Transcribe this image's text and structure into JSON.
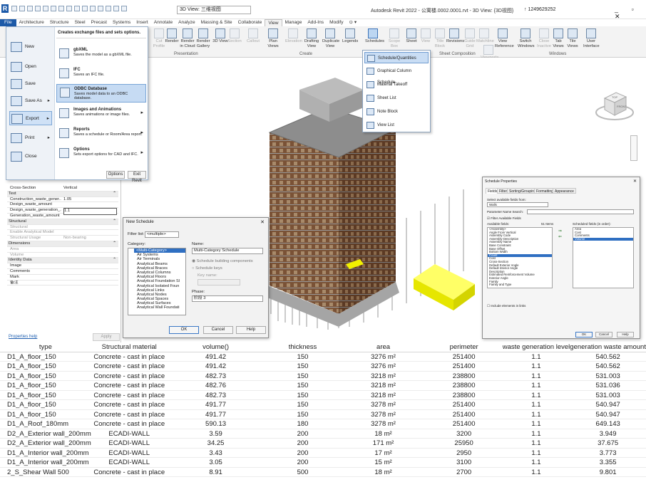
{
  "app": {
    "logo": "R",
    "title": "Autodesk Revit 2022 - 公寓楼.0002.0001.rvt - 3D View: {3D视图}",
    "view_combo": "3D View: 三维视图",
    "account": "↑ 1249629252",
    "window_buttons": "_ ▫ ✕"
  },
  "menu_tabs": [
    "File",
    "Architecture",
    "Structure",
    "Steel",
    "Precast",
    "Systems",
    "Insert",
    "Annotate",
    "Analyze",
    "Massing & Site",
    "Collaborate",
    "View",
    "Manage",
    "Add-Ins",
    "Modify",
    "⊙ ▾"
  ],
  "active_tab": "View",
  "ribbon": {
    "buttons": [
      {
        "label": "Cut Profile",
        "dim": true
      },
      {
        "label": "Render",
        "dim": false
      },
      {
        "label": "Render in Cloud",
        "dim": false
      },
      {
        "label": "Render Gallery",
        "dim": false
      },
      {
        "label": "3D View",
        "dim": false
      },
      {
        "label": "Section",
        "dim": true
      },
      {
        "label": "Callout",
        "dim": true
      },
      {
        "label": "Plan Views",
        "dim": false
      },
      {
        "label": "Elevation",
        "dim": true
      },
      {
        "label": "Drafting View",
        "dim": false
      },
      {
        "label": "Duplicate View",
        "dim": false
      },
      {
        "label": "Legends",
        "dim": false
      },
      {
        "label": "Schedules",
        "dim": false
      },
      {
        "label": "Scope Box",
        "dim": true
      },
      {
        "label": "Sheet",
        "dim": false
      },
      {
        "label": "View",
        "dim": true
      },
      {
        "label": "Title Block",
        "dim": true
      },
      {
        "label": "Revisions",
        "dim": false
      },
      {
        "label": "Guide Grid",
        "dim": true
      },
      {
        "label": "Matchline",
        "dim": true
      },
      {
        "label": "View Reference",
        "dim": false
      },
      {
        "label": "Viewports",
        "dim": true
      },
      {
        "label": "Switch Windows",
        "dim": false
      },
      {
        "label": "Close Inactive",
        "dim": true
      },
      {
        "label": "Tab Views",
        "dim": false
      },
      {
        "label": "Tile Views",
        "dim": false
      },
      {
        "label": "User Interface",
        "dim": false
      }
    ],
    "groups": [
      "Presentation",
      "Create",
      "Sheet Composition",
      "Windows"
    ]
  },
  "file_menu": {
    "items": [
      "New",
      "Open",
      "Save",
      "Save As",
      "Export",
      "Print",
      "Close"
    ],
    "selected": "Export",
    "header": "Creates exchange files and sets options.",
    "exports": [
      {
        "title": "gbXML",
        "desc": "Saves the model as a gbXML file."
      },
      {
        "title": "IFC",
        "desc": "Saves an IFC file."
      },
      {
        "title": "ODBC Database",
        "desc": "Saves model data to an ODBC database."
      },
      {
        "title": "Images and Animations",
        "desc": "Saves animations or image files."
      },
      {
        "title": "Reports",
        "desc": "Saves a schedule or Room/Area report."
      },
      {
        "title": "Options",
        "desc": "Sets export options for CAD and IFC."
      }
    ],
    "options_btn": "Options",
    "exit_btn": "Exit Revit"
  },
  "schedule_menu": {
    "items": [
      "Schedule/Quantities",
      "Graphical Column Schedule",
      "Material Takeoff",
      "Sheet List",
      "Note Block",
      "View List"
    ],
    "selected": "Schedule/Quantities"
  },
  "properties": {
    "rows": [
      {
        "k": "Cross-Section",
        "v": "Vertical",
        "type": "row"
      },
      {
        "k": "Text",
        "v": "",
        "type": "hdr"
      },
      {
        "k": "Construction_waste_gener...",
        "v": "1.05",
        "type": "row"
      },
      {
        "k": "Design_waste_amount",
        "v": "",
        "type": "row"
      },
      {
        "k": "Design_waste_generation_...",
        "v": "1.1",
        "type": "row"
      },
      {
        "k": "Generation_waste_amount",
        "v": "",
        "type": "row"
      },
      {
        "k": "Structural",
        "v": "",
        "type": "hdr"
      },
      {
        "k": "Structural",
        "v": "",
        "type": "gray"
      },
      {
        "k": "Enable Analytical Model",
        "v": "",
        "type": "gray"
      },
      {
        "k": "Structural Usage",
        "v": "Non-bearing",
        "type": "gray"
      },
      {
        "k": "Dimensions",
        "v": "",
        "type": "hdr"
      },
      {
        "k": "Area",
        "v": "",
        "type": "gray"
      },
      {
        "k": "Volume",
        "v": "",
        "type": "gray"
      },
      {
        "k": "Identity Data",
        "v": "",
        "type": "hdr"
      },
      {
        "k": "Image",
        "v": "",
        "type": "row"
      },
      {
        "k": "Comments",
        "v": "",
        "type": "row"
      },
      {
        "k": "Mark",
        "v": "",
        "type": "row"
      },
      {
        "k": "备注",
        "v": "",
        "type": "row"
      }
    ],
    "help_link": "Properties help",
    "apply": "Apply"
  },
  "new_schedule": {
    "title": "New Schedule",
    "filter_label": "Filter list:",
    "filter_value": "<multiple>",
    "category_label": "Category:",
    "categories": [
      "<Multi-Category>",
      "Air Systems",
      "Air Terminals",
      "Analytical Beams",
      "Analytical Braces",
      "Analytical Columns",
      "Analytical Floors",
      "Analytical Foundation Sl",
      "Analytical Isolated Foun",
      "Analytical Links",
      "Analytical Nodes",
      "Analytical Spaces",
      "Analytical Surfaces",
      "Analytical Wall Foundati"
    ],
    "name_label": "Name:",
    "name_value": "Multi-Category Schedule",
    "schedule_building": "Schedule building components",
    "schedule_keys": "Schedule keys",
    "key_name": "Key name:",
    "phase_label": "Phase:",
    "phase_value": "阶段 3",
    "ok": "OK",
    "cancel": "Cancel",
    "help": "Help"
  },
  "schedule_properties": {
    "title": "Schedule Properties",
    "tabs": [
      "Fields",
      "Filter",
      "Sorting/Grouping",
      "Formatting",
      "Appearance"
    ],
    "select_from_label": "Select available fields from:",
    "select_from_value": "Walls",
    "param_search": "Parameter Name Search:",
    "filter_available": "Filter Available Fields",
    "available_label": "Available fields:",
    "available_count": "51 Items",
    "available": [
      "<Assembly>",
      "Angle From Vertical",
      "Assembly Code",
      "Assembly Description",
      "Assembly Name",
      "Base Constraint",
      "Base Offset",
      "Bottom Width",
      "Count",
      "Cost",
      "Cross-Section",
      "Default Exterior Angle",
      "Default Interior Angle",
      "Description",
      "Estimated Reinforcement Volume",
      "Exterior Angle",
      "Family",
      "Family and Type"
    ],
    "available_selected": "Count",
    "scheduled_label": "Scheduled fields (in order):",
    "scheduled": [
      "Area",
      "Cost",
      "Comments",
      "Volume"
    ],
    "scheduled_selected": "Volume",
    "include_links": "Include elements in links",
    "ok": "OK",
    "cancel": "Cancel",
    "help": "Help"
  },
  "table": {
    "columns": [
      "type",
      "Structural material",
      "volume()",
      "thickness",
      "area",
      "perimeter",
      "waste generation level",
      "generation waste amount"
    ],
    "rows": [
      [
        "D1_A_floor_150",
        "Concrete - cast in place",
        "491.42",
        "150",
        "3276 m²",
        "251400",
        "1.1",
        "540.562"
      ],
      [
        "D1_A_floor_150",
        "Concrete - cast in place",
        "491.42",
        "150",
        "3276 m²",
        "251400",
        "1.1",
        "540.562"
      ],
      [
        "D1_A_floor_150",
        "Concrete - cast in place",
        "482.73",
        "150",
        "3218 m²",
        "238800",
        "1.1",
        "531.003"
      ],
      [
        "D1_A_floor_150",
        "Concrete - cast in place",
        "482.76",
        "150",
        "3218 m²",
        "238800",
        "1.1",
        "531.036"
      ],
      [
        "D1_A_floor_150",
        "Concrete - cast in place",
        "482.73",
        "150",
        "3218 m²",
        "238800",
        "1.1",
        "531.003"
      ],
      [
        "D1_A_floor_150",
        "Concrete - cast in place",
        "491.77",
        "150",
        "3278 m²",
        "251400",
        "1.1",
        "540.947"
      ],
      [
        "D1_A_floor_150",
        "Concrete - cast in place",
        "491.77",
        "150",
        "3278 m²",
        "251400",
        "1.1",
        "540.947"
      ],
      [
        "D1_A_Roof_180mm",
        "Concrete - cast in place",
        "590.13",
        "180",
        "3278 m²",
        "251400",
        "1.1",
        "649.143"
      ],
      [
        "D2_A_Exterior wall_200mm",
        "ECADI-WALL",
        "3.59",
        "200",
        "18 m²",
        "3200",
        "1.1",
        "3.949"
      ],
      [
        "D2_A_Exterior wall_200mm",
        "ECADI-WALL",
        "34.25",
        "200",
        "171 m²",
        "25950",
        "1.1",
        "37.675"
      ],
      [
        "D1_A_Interior wall_200mm",
        "ECADI-WALL",
        "3.43",
        "200",
        "17 m²",
        "2950",
        "1.1",
        "3.773"
      ],
      [
        "D1_A_Interior wall_200mm",
        "ECADI-WALL",
        "3.05",
        "200",
        "15 m²",
        "3100",
        "1.1",
        "3.355"
      ],
      [
        "2_S_Shear Wall 500",
        "Concrete - cast in place",
        "8.91",
        "500",
        "18 m²",
        "2700",
        "1.1",
        "9.801"
      ]
    ]
  },
  "navcube": {
    "top": "TOP",
    "front": "FRONT"
  }
}
